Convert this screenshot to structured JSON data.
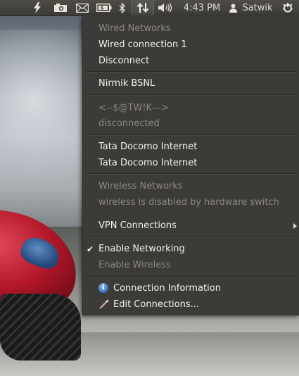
{
  "panel": {
    "clock": "4:43 PM",
    "user": "Satwik",
    "icons": [
      "lightning-icon",
      "camera-icon",
      "mail-icon",
      "battery-icon",
      "bluetooth-icon",
      "network-updown-icon",
      "volume-icon",
      "user-icon",
      "power-gear-icon"
    ]
  },
  "menu": {
    "wired_header": "Wired Networks",
    "wired_connection": "Wired connection 1",
    "disconnect": "Disconnect",
    "nirmik": "Nirmik BSNL",
    "mystery_name": "<--$@TW!K—>",
    "mystery_status": "disconnected",
    "tata1": "Tata Docomo Internet",
    "tata2": "Tata Docomo Internet",
    "wireless_header": "Wireless Networks",
    "wireless_disabled": "wireless is disabled by hardware switch",
    "vpn": "VPN Connections",
    "enable_networking": "Enable Networking",
    "enable_networking_checked": true,
    "enable_wireless": "Enable Wireless",
    "connection_info": "Connection Information",
    "edit_connections": "Edit Connections..."
  },
  "colors": {
    "menu_bg": "#3c3b37",
    "text": "#f2f1ed",
    "disabled_text": "#8a877f"
  }
}
